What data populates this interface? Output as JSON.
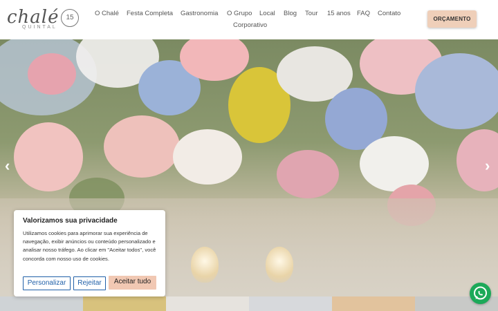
{
  "brand": {
    "name": "chalé",
    "subtitle": "QUINTAL",
    "badge": "15"
  },
  "nav": [
    "O Chalé",
    "Festa Completa",
    "Gastronomia",
    "O Grupo",
    "Local",
    "Blog",
    "Tour",
    "15 anos",
    "FAQ",
    "Contato",
    "Corporativo"
  ],
  "cta_label": "ORÇAMENTO",
  "hero": {
    "prev_icon": "chevron-left-icon",
    "next_icon": "chevron-right-icon"
  },
  "cookie": {
    "title": "Valorizamos sua privacidade",
    "text": "Utilizamos cookies para aprimorar sua experiência de navegação, exibir anúncios ou conteúdo personalizado e analisar nosso tráfego. Ao clicar em \"Aceitar todos\", você concorda com nosso uso de cookies.",
    "customize": "Personalizar",
    "reject": "Rejeitar",
    "accept": "Aceitar tudo"
  },
  "colors": {
    "accent": "#efcfb9",
    "button_blue": "#1f5fa8",
    "whatsapp": "#1ca959"
  }
}
